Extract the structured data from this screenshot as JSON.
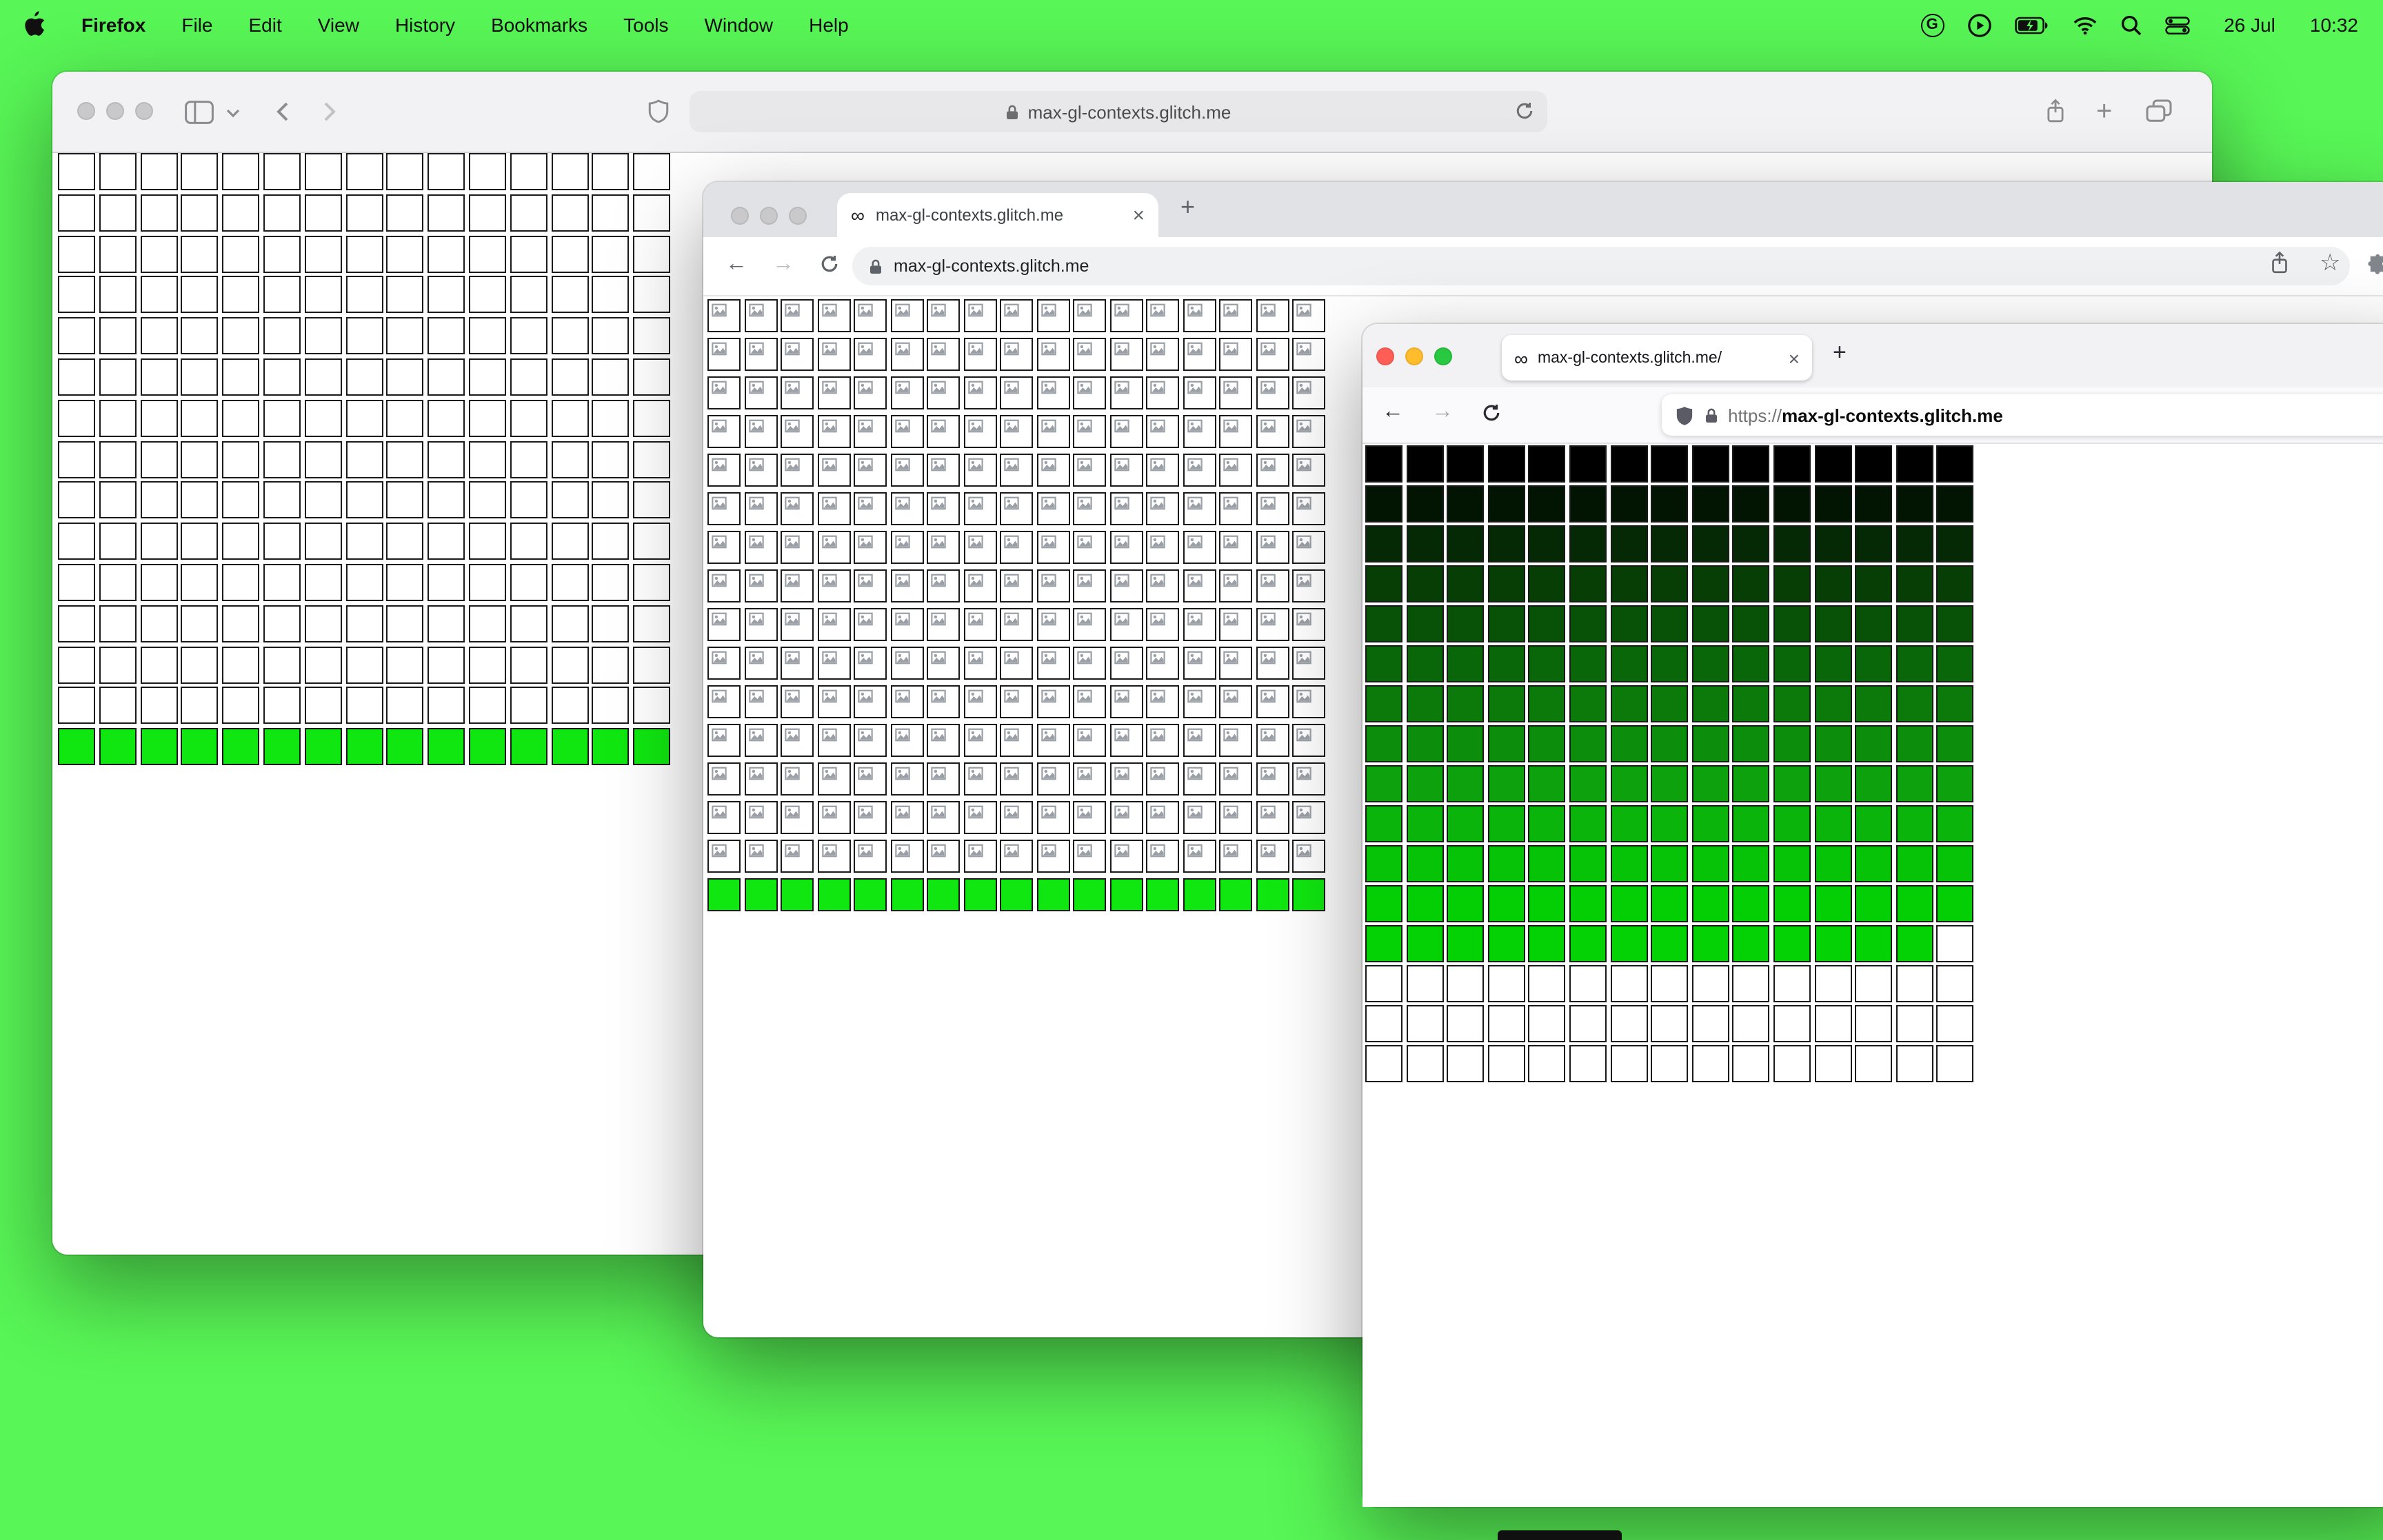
{
  "desktop": {
    "background": "#58f656",
    "bottom_sliver_color": "#101010"
  },
  "menu_bar": {
    "app_name": "Firefox",
    "menus": [
      "File",
      "Edit",
      "View",
      "History",
      "Bookmarks",
      "Tools",
      "Window",
      "Help"
    ],
    "clock_date": "26 Jul",
    "clock_time": "10:32"
  },
  "icons": {
    "infinity_glyph": "∞",
    "close_glyph": "×",
    "plus_glyph": "+",
    "back_glyph": "←",
    "forward_glyph": "→",
    "star_glyph": "☆",
    "google_glyph": "G"
  },
  "safari": {
    "url": "max-gl-contexts.glitch.me",
    "grid": {
      "cols": 15,
      "cell": 27,
      "col_gap": 2.8,
      "row_gap": 2.8,
      "rows": [
        {
          "fill": "white",
          "count": 14
        },
        {
          "fill": "#10e710",
          "count": 1
        }
      ]
    }
  },
  "chrome": {
    "tab_title": "max-gl-contexts.glitch.me",
    "url": "max-gl-contexts.glitch.me",
    "grid": {
      "cols": 17,
      "cell": 24,
      "col_gap": 2.5,
      "row_gap": 4,
      "rows": [
        {
          "fill": "broken",
          "count": 15
        },
        {
          "fill": "#10e710",
          "count": 1
        }
      ]
    }
  },
  "firefox": {
    "tab_title": "max-gl-contexts.glitch.me/",
    "url_scheme": "https://",
    "url_host": "max-gl-contexts.glitch.me",
    "grid": {
      "cols": 15,
      "cell": 27,
      "col_gap": 2.6,
      "row_gap": 2,
      "rows": [
        {
          "fill": "#000000"
        },
        {
          "fill": "#021502"
        },
        {
          "fill": "#042904"
        },
        {
          "fill": "#063e06"
        },
        {
          "fill": "#085208"
        },
        {
          "fill": "#096609"
        },
        {
          "fill": "#0b7a0b"
        },
        {
          "fill": "#0c8e0c"
        },
        {
          "fill": "#0da20d"
        },
        {
          "fill": "#0bb40b"
        },
        {
          "fill": "#07c307"
        },
        {
          "fill": "#04ce04"
        },
        {
          "fill": "#04d204",
          "white_tail": 1
        },
        {
          "fill": "white",
          "count": 3
        }
      ]
    }
  }
}
